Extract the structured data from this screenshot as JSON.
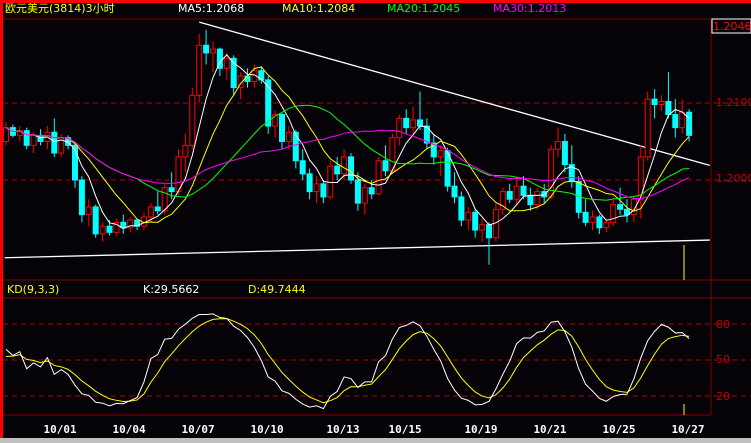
{
  "header": {
    "title": "欧元美元(3814)3小时",
    "ma5": "MA5:1.2068",
    "ma10": "MA10:1.2084",
    "ma20": "MA20:1.2045",
    "ma30": "MA30:1.2013",
    "current_price": "1.2046"
  },
  "kd_header": {
    "title": "KD(9,3,3)",
    "k": "K:29.5662",
    "d": "D:49.7444"
  },
  "colors": {
    "up": "#ff0000",
    "down": "#00ffff",
    "ma5": "#ffffff",
    "ma10": "#ffff00",
    "ma20": "#00ff00",
    "ma30": "#ff00ff",
    "grid": "#b00000",
    "frame": "#800000",
    "trendline": "#ffffff"
  },
  "chart_data": [
    {
      "type": "candlestick",
      "title": "欧元美元(3814)3小时",
      "ylabel_ticks": [
        "1.2100",
        "1.2000"
      ],
      "yticks": [
        1.21,
        1.2
      ],
      "ylim": [
        1.1909,
        1.2197
      ],
      "grid": "dashed horizontal",
      "x_ticks": [
        {
          "index": 9,
          "label": "10/01"
        },
        {
          "index": 19,
          "label": "10/04"
        },
        {
          "index": 29,
          "label": "10/07"
        },
        {
          "index": 39,
          "label": "10/10"
        },
        {
          "index": 50,
          "label": "10/13"
        },
        {
          "index": 59,
          "label": "10/15"
        },
        {
          "index": 70,
          "label": "10/19"
        },
        {
          "index": 80,
          "label": "10/21"
        },
        {
          "index": 90,
          "label": "10/25"
        },
        {
          "index": 100,
          "label": "10/27"
        }
      ],
      "moving_averages": [
        5,
        10,
        20,
        30
      ],
      "trendlines": [
        {
          "from": [
            28,
            1.2205
          ],
          "to": [
            102,
            1.2019
          ]
        },
        {
          "from": [
            -0.2,
            1.1899
          ],
          "to": [
            102,
            1.1922
          ]
        }
      ],
      "candles_ohlc": [
        [
          1.205,
          1.2075,
          1.2045,
          1.2068
        ],
        [
          1.2068,
          1.2072,
          1.2055,
          1.2058
        ],
        [
          1.2058,
          1.207,
          1.205,
          1.2064
        ],
        [
          1.2064,
          1.2068,
          1.204,
          1.2045
        ],
        [
          1.2045,
          1.2062,
          1.2035,
          1.2058
        ],
        [
          1.2058,
          1.2066,
          1.2045,
          1.205
        ],
        [
          1.205,
          1.207,
          1.204,
          1.2062
        ],
        [
          1.2062,
          1.208,
          1.203,
          1.2035
        ],
        [
          1.2035,
          1.206,
          1.203,
          1.2055
        ],
        [
          1.2055,
          1.2058,
          1.204,
          1.2045
        ],
        [
          1.2045,
          1.205,
          1.199,
          1.2
        ],
        [
          1.2,
          1.2005,
          1.1945,
          1.1955
        ],
        [
          1.1955,
          1.1975,
          1.194,
          1.1965
        ],
        [
          1.1965,
          1.1968,
          1.1925,
          1.193
        ],
        [
          1.193,
          1.1945,
          1.192,
          1.194
        ],
        [
          1.194,
          1.1948,
          1.1928,
          1.1932
        ],
        [
          1.1932,
          1.195,
          1.1928,
          1.1945
        ],
        [
          1.1945,
          1.1955,
          1.193,
          1.1938
        ],
        [
          1.1938,
          1.1952,
          1.1932,
          1.1948
        ],
        [
          1.1948,
          1.195,
          1.1935,
          1.194
        ],
        [
          1.194,
          1.1958,
          1.1935,
          1.1952
        ],
        [
          1.1952,
          1.197,
          1.1945,
          1.1965
        ],
        [
          1.1965,
          1.1985,
          1.1955,
          1.196
        ],
        [
          1.196,
          1.1995,
          1.1955,
          1.199
        ],
        [
          1.199,
          1.201,
          1.1975,
          1.1985
        ],
        [
          1.1985,
          1.204,
          1.198,
          1.203
        ],
        [
          1.203,
          1.206,
          1.201,
          1.2045
        ],
        [
          1.2045,
          1.212,
          1.204,
          1.211
        ],
        [
          1.211,
          1.219,
          1.21,
          1.2175
        ],
        [
          1.2175,
          1.2195,
          1.215,
          1.2165
        ],
        [
          1.2165,
          1.218,
          1.214,
          1.217
        ],
        [
          1.217,
          1.2172,
          1.2135,
          1.2145
        ],
        [
          1.2145,
          1.2165,
          1.213,
          1.2158
        ],
        [
          1.2158,
          1.2162,
          1.211,
          1.212
        ],
        [
          1.212,
          1.214,
          1.2105,
          1.2135
        ],
        [
          1.2135,
          1.2145,
          1.212,
          1.2128
        ],
        [
          1.2128,
          1.215,
          1.212,
          1.2142
        ],
        [
          1.2142,
          1.2148,
          1.2125,
          1.213
        ],
        [
          1.213,
          1.2135,
          1.206,
          1.207
        ],
        [
          1.207,
          1.209,
          1.2055,
          1.2085
        ],
        [
          1.2085,
          1.2088,
          1.204,
          1.205
        ],
        [
          1.205,
          1.207,
          1.204,
          1.2062
        ],
        [
          1.2062,
          1.2065,
          1.2015,
          1.2025
        ],
        [
          1.2025,
          1.204,
          1.2,
          1.2008
        ],
        [
          1.2008,
          1.2015,
          1.1975,
          1.1985
        ],
        [
          1.1985,
          1.2005,
          1.197,
          1.1995
        ],
        [
          1.1995,
          1.2,
          1.197,
          1.1978
        ],
        [
          1.1978,
          1.2025,
          1.1975,
          1.2018
        ],
        [
          1.2018,
          1.203,
          1.2,
          1.2008
        ],
        [
          1.2008,
          1.204,
          1.2,
          1.203
        ],
        [
          1.203,
          1.2035,
          1.1995,
          1.2
        ],
        [
          1.2,
          1.201,
          1.196,
          1.197
        ],
        [
          1.197,
          1.1995,
          1.1955,
          1.199
        ],
        [
          1.199,
          1.2,
          1.1975,
          1.1982
        ],
        [
          1.1982,
          1.203,
          1.198,
          1.2025
        ],
        [
          1.2025,
          1.2045,
          1.2005,
          1.2012
        ],
        [
          1.2012,
          1.206,
          1.201,
          1.2055
        ],
        [
          1.2055,
          1.2085,
          1.2045,
          1.208
        ],
        [
          1.208,
          1.2092,
          1.206,
          1.2068
        ],
        [
          1.2068,
          1.2095,
          1.206,
          1.2078
        ],
        [
          1.2078,
          1.2115,
          1.2065,
          1.207
        ],
        [
          1.207,
          1.208,
          1.204,
          1.2048
        ],
        [
          1.2048,
          1.206,
          1.202,
          1.203
        ],
        [
          1.203,
          1.2045,
          1.2005,
          1.2038
        ],
        [
          1.2038,
          1.2042,
          1.1985,
          1.1992
        ],
        [
          1.1992,
          1.201,
          1.197,
          1.1978
        ],
        [
          1.1978,
          1.1985,
          1.194,
          1.1948
        ],
        [
          1.1948,
          1.1965,
          1.1935,
          1.1958
        ],
        [
          1.1958,
          1.1962,
          1.1925,
          1.1935
        ],
        [
          1.1935,
          1.195,
          1.192,
          1.1942
        ],
        [
          1.1942,
          1.1945,
          1.189,
          1.1925
        ],
        [
          1.1925,
          1.197,
          1.192,
          1.1962
        ],
        [
          1.1962,
          1.199,
          1.1955,
          1.1985
        ],
        [
          1.1985,
          1.1995,
          1.197,
          1.1975
        ],
        [
          1.1975,
          1.2,
          1.1968,
          1.1992
        ],
        [
          1.1992,
          1.2005,
          1.1975,
          1.198
        ],
        [
          1.198,
          1.199,
          1.196,
          1.1968
        ],
        [
          1.1968,
          1.199,
          1.1962,
          1.1985
        ],
        [
          1.1985,
          1.1995,
          1.197,
          1.1978
        ],
        [
          1.1978,
          1.2045,
          1.1975,
          1.204
        ],
        [
          1.204,
          1.2068,
          1.203,
          1.205
        ],
        [
          1.205,
          1.206,
          1.201,
          1.202
        ],
        [
          1.202,
          1.2045,
          1.199,
          1.1998
        ],
        [
          1.1998,
          1.2005,
          1.195,
          1.1958
        ],
        [
          1.1958,
          1.1975,
          1.194,
          1.1945
        ],
        [
          1.1945,
          1.196,
          1.1935,
          1.1952
        ],
        [
          1.1952,
          1.1955,
          1.193,
          1.1938
        ],
        [
          1.1938,
          1.195,
          1.1932,
          1.1945
        ],
        [
          1.1945,
          1.1975,
          1.194,
          1.1968
        ],
        [
          1.1968,
          1.199,
          1.1955,
          1.1962
        ],
        [
          1.1962,
          1.1975,
          1.1945,
          1.1955
        ],
        [
          1.1955,
          1.198,
          1.1945,
          1.1975
        ],
        [
          1.1975,
          1.2045,
          1.195,
          1.203
        ],
        [
          1.203,
          1.2115,
          1.2025,
          1.2105
        ],
        [
          1.2105,
          1.2118,
          1.208,
          1.2098
        ],
        [
          1.2098,
          1.211,
          1.209,
          1.2102
        ],
        [
          1.2102,
          1.214,
          1.208,
          1.2085
        ],
        [
          1.2085,
          1.2105,
          1.2055,
          1.2068
        ],
        [
          1.2068,
          1.2105,
          1.206,
          1.2088
        ],
        [
          1.2088,
          1.2092,
          1.205,
          1.2058
        ]
      ]
    },
    {
      "type": "line",
      "title": "KD(9,3,3)",
      "series": [
        {
          "name": "K"
        },
        {
          "name": "D"
        }
      ],
      "ylim": [
        0,
        100
      ],
      "yticks": [
        80,
        50,
        20
      ],
      "ylabel_ticks": [
        "80",
        "50",
        "20"
      ],
      "params": [
        9,
        3,
        3
      ]
    }
  ]
}
